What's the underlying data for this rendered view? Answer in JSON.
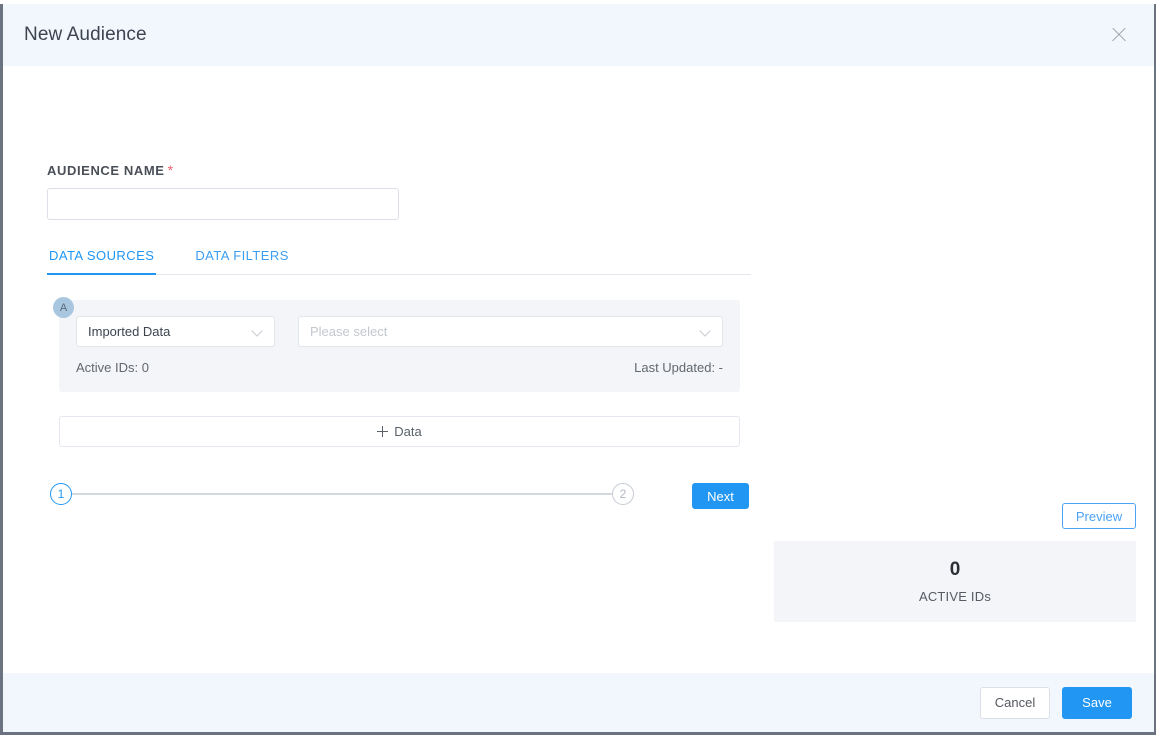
{
  "modal": {
    "title": "New Audience",
    "close_icon": "close-icon"
  },
  "form": {
    "audience_name_label": "AUDIENCE NAME",
    "required_marker": "*",
    "audience_name_value": "",
    "audience_name_placeholder": ""
  },
  "tabs": [
    {
      "label": "DATA SOURCES",
      "active": true
    },
    {
      "label": "DATA FILTERS",
      "active": false
    }
  ],
  "data_sources": [
    {
      "badge": "A",
      "type_select": {
        "value": "Imported Data",
        "icon": "chevron-down-icon"
      },
      "value_select": {
        "value": "",
        "placeholder": "Please select",
        "icon": "chevron-down-icon"
      },
      "active_ids": "Active IDs: 0",
      "last_updated": "Last Updated: -"
    }
  ],
  "add_data": {
    "label": "Data",
    "icon": "plus-icon"
  },
  "stepper": {
    "steps": [
      {
        "number": "1",
        "active": true
      },
      {
        "number": "2",
        "active": false
      }
    ],
    "next_label": "Next"
  },
  "right_panel": {
    "preview_label": "Preview",
    "stat_value": "0",
    "stat_label": "ACTIVE IDs"
  },
  "footer": {
    "cancel_label": "Cancel",
    "save_label": "Save"
  },
  "colors": {
    "accent": "#2196f3",
    "required": "#f4606c",
    "header_bg": "#f1f7fd",
    "card_bg": "#f3f5f8",
    "badge_bg": "#a9c6e0"
  }
}
